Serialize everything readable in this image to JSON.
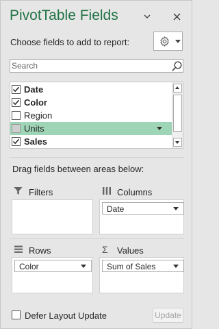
{
  "pane": {
    "title": "PivotTable Fields",
    "choose_label": "Choose fields to add to report:",
    "accent_color": "#217346"
  },
  "header_icons": [
    "chevron-down-icon",
    "close-icon"
  ],
  "search": {
    "placeholder": "Search",
    "value": ""
  },
  "fields": [
    {
      "label": "Date",
      "checked": true,
      "bold": true,
      "highlighted": false
    },
    {
      "label": "Color",
      "checked": true,
      "bold": true,
      "highlighted": false
    },
    {
      "label": "Region",
      "checked": false,
      "bold": false,
      "highlighted": false
    },
    {
      "label": "Units",
      "checked": false,
      "bold": false,
      "highlighted": true
    },
    {
      "label": "Sales",
      "checked": true,
      "bold": true,
      "highlighted": false
    }
  ],
  "drag_label": "Drag fields between areas below:",
  "areas": {
    "filters": {
      "title": "Filters",
      "items": []
    },
    "columns": {
      "title": "Columns",
      "items": [
        "Date"
      ]
    },
    "rows": {
      "title": "Rows",
      "items": [
        "Color"
      ]
    },
    "values": {
      "title": "Values",
      "items": [
        "Sum of Sales"
      ]
    }
  },
  "footer": {
    "defer_label": "Defer Layout Update",
    "defer_checked": false,
    "update_label": "Update"
  },
  "colors": {
    "highlight": "#9fd5b7",
    "title": "#217346"
  }
}
